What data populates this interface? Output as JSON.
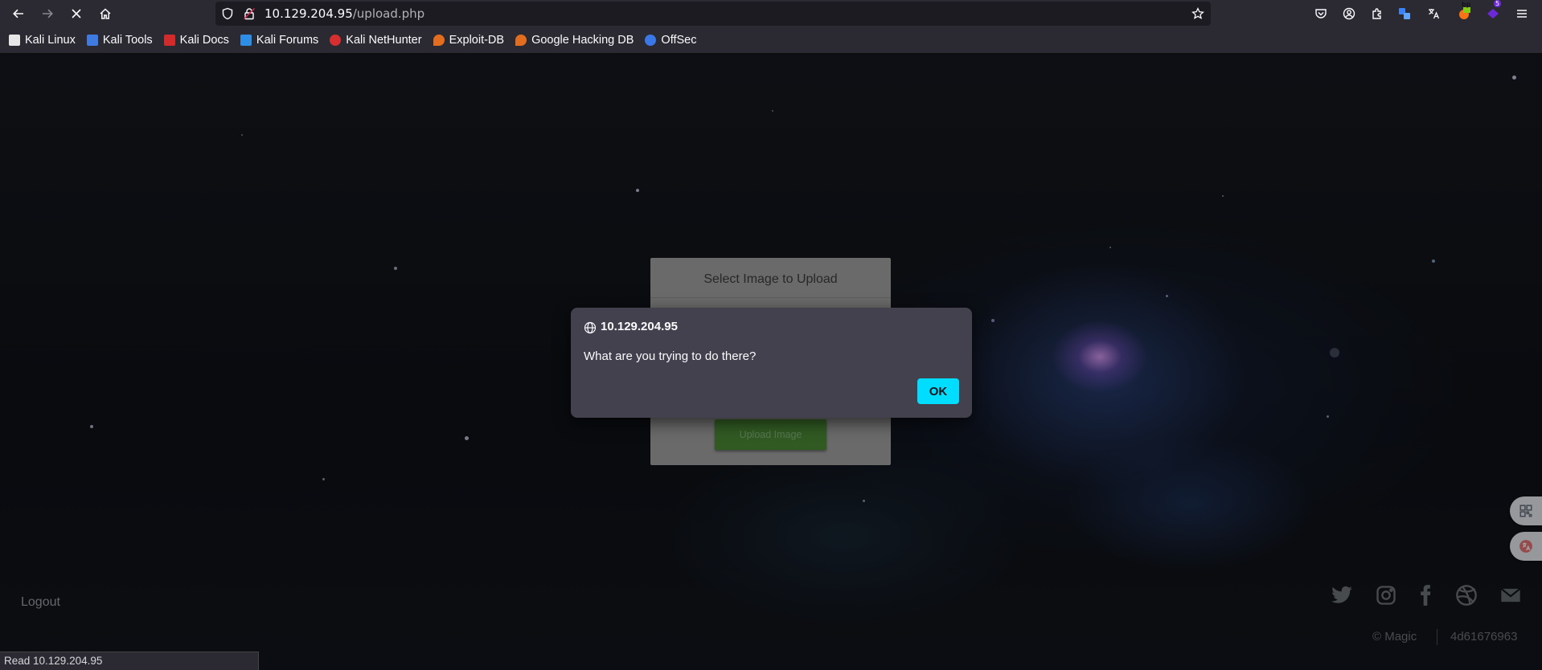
{
  "browser": {
    "url_host": "10.129.204.95",
    "url_path": "/upload.php",
    "status_text": "Read 10.129.204.95",
    "extension_badges": {
      "bp": "bp",
      "count": "5"
    }
  },
  "bookmarks": [
    {
      "label": "Kali Linux",
      "icon": "kali-dragon-icon",
      "color": "#e6e6e6"
    },
    {
      "label": "Kali Tools",
      "icon": "kali-tools-icon",
      "color": "#3f7ae0"
    },
    {
      "label": "Kali Docs",
      "icon": "kali-docs-icon",
      "color": "#d12b2b"
    },
    {
      "label": "Kali Forums",
      "icon": "kali-forums-icon",
      "color": "#2e8de5"
    },
    {
      "label": "Kali NetHunter",
      "icon": "nethunter-icon",
      "color": "#d62f2f"
    },
    {
      "label": "Exploit-DB",
      "icon": "exploit-db-icon",
      "color": "#e36d1f"
    },
    {
      "label": "Google Hacking DB",
      "icon": "ghdb-icon",
      "color": "#e36d1f"
    },
    {
      "label": "OffSec",
      "icon": "offsec-icon",
      "color": "#3b78e7"
    }
  ],
  "page": {
    "upload_title": "Select Image to Upload",
    "upload_button": "Upload Image",
    "logout": "Logout",
    "copyright": "© Magic",
    "hash": "4d61676963",
    "social_icons": [
      "twitter-icon",
      "instagram-icon",
      "facebook-icon",
      "dribbble-icon",
      "mail-icon"
    ]
  },
  "dialog": {
    "host": "10.129.204.95",
    "message": "What are you trying to do there?",
    "ok_label": "OK"
  },
  "colors": {
    "chrome_bg": "#2b2a33",
    "dialog_bg": "#42414d",
    "ok_button": "#00ddff",
    "upload_button": "#4c8a36"
  }
}
